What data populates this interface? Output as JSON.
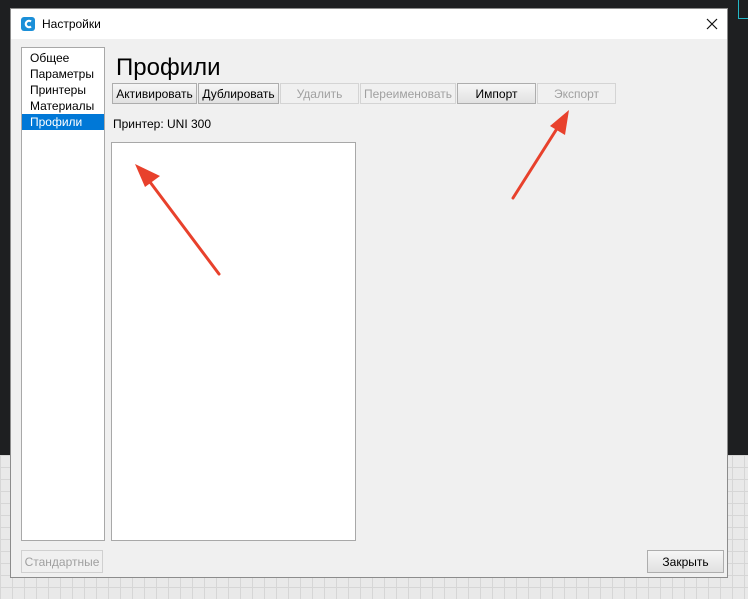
{
  "window": {
    "title": "Настройки"
  },
  "sidebar": {
    "items": [
      {
        "label": "Общее"
      },
      {
        "label": "Параметры"
      },
      {
        "label": "Принтеры"
      },
      {
        "label": "Материалы"
      },
      {
        "label": "Профили",
        "selected": true
      }
    ]
  },
  "main": {
    "page_title": "Профили",
    "printer_label": "Принтер: UNI 300",
    "toolbar": {
      "activate": "Активировать",
      "duplicate": "Дублировать",
      "delete": "Удалить",
      "rename": "Переименовать",
      "import": "Импорт",
      "export": "Экспорт"
    }
  },
  "footer": {
    "defaults_label": "Стандартные",
    "close_label": "Закрыть"
  },
  "colors": {
    "accent": "#0078d7",
    "annotation_arrow": "#e8412c",
    "app_icon": "#1b8fd8"
  },
  "icons": {
    "app": "cura-logo-icon",
    "close": "close-icon"
  }
}
